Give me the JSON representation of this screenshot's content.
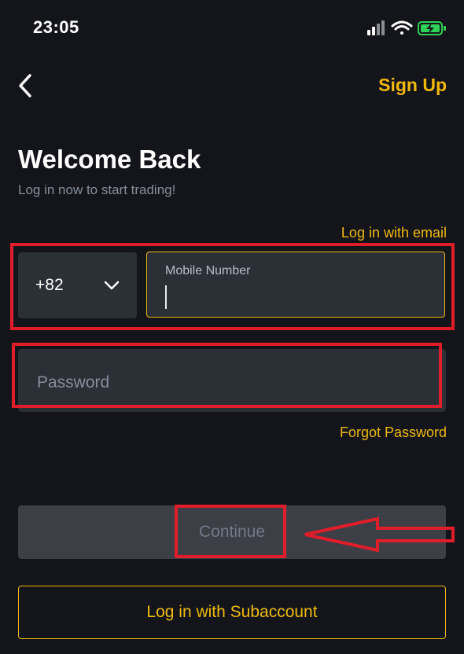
{
  "status_bar": {
    "time": "23:05",
    "icons": [
      "signal-icon",
      "wifi-icon",
      "battery-charging-icon"
    ]
  },
  "nav": {
    "back_icon": "chevron-left-icon",
    "sign_up_label": "Sign Up"
  },
  "header": {
    "title": "Welcome Back",
    "subtitle": "Log in now to start trading!"
  },
  "form": {
    "email_link": "Log in with email",
    "country_code": "+82",
    "mobile_label": "Mobile Number",
    "mobile_value": "",
    "password_placeholder": "Password",
    "forgot_link": "Forgot Password",
    "continue_label": "Continue",
    "subaccount_label": "Log in with Subaccount"
  },
  "colors": {
    "background": "#14151a",
    "accent": "#f0b90b",
    "field": "#2b2f36",
    "disabled_button": "#3c3f45",
    "annotation": "#e11d2a"
  }
}
